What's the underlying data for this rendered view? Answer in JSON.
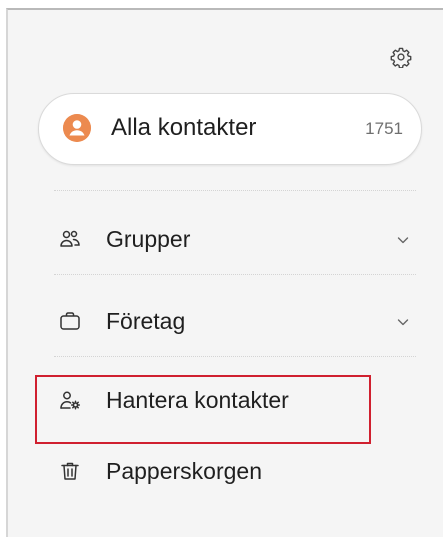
{
  "drawer": {
    "all_contacts": {
      "label": "Alla kontakter",
      "count": "1751"
    },
    "items": [
      {
        "label": "Grupper",
        "icon": "groups-icon",
        "expandable": true
      },
      {
        "label": "Företag",
        "icon": "briefcase-icon",
        "expandable": true
      },
      {
        "label": "Hantera kontakter",
        "icon": "manage-contacts-icon",
        "expandable": false,
        "highlighted": true
      },
      {
        "label": "Papperskorgen",
        "icon": "trash-icon",
        "expandable": false
      }
    ]
  },
  "colors": {
    "avatar": "#ec8a4f",
    "highlight_border": "#d0202f",
    "drawer_background": "#f5f5f5"
  }
}
